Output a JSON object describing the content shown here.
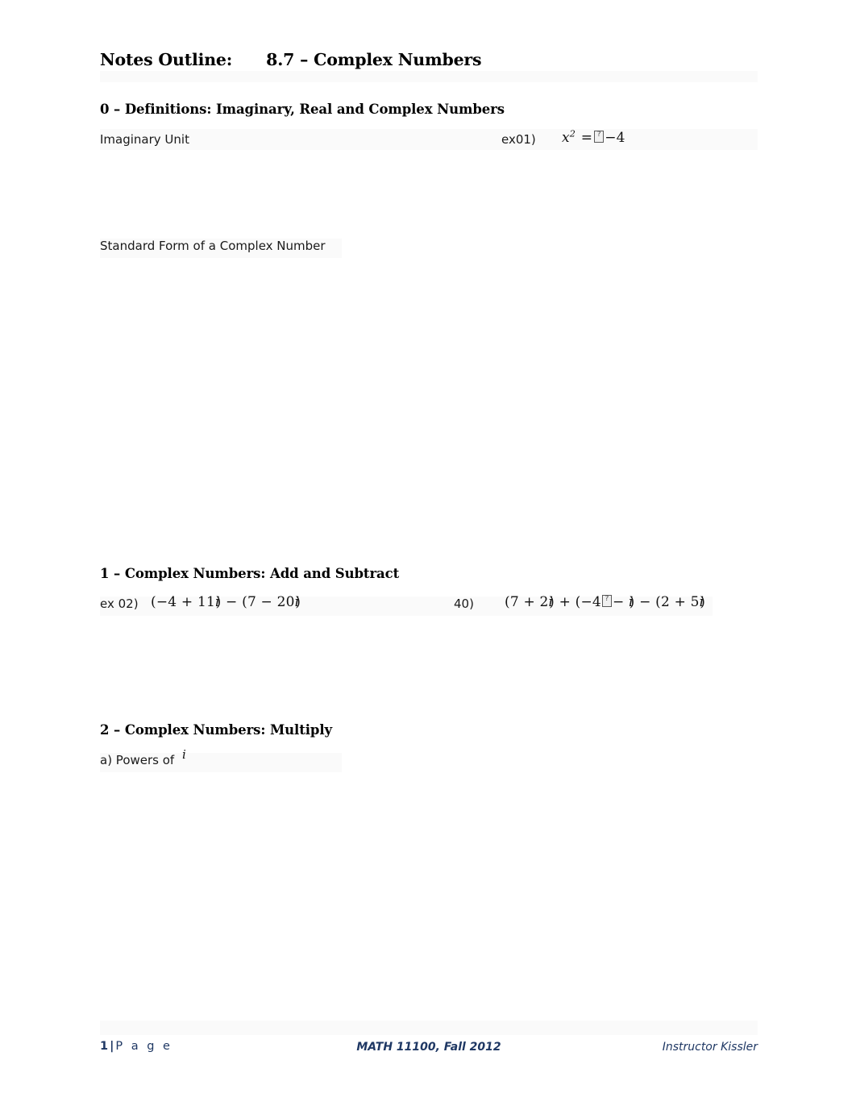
{
  "document": {
    "title_prefix": "Notes Outline:",
    "title_main": "8.7 – Complex Numbers",
    "accent_color": "#1f3864",
    "text_color": "#1a1a1a",
    "page_background": "#ffffff"
  },
  "sections": [
    {
      "heading": "0 – Definitions: Imaginary, Real and Complex Numbers",
      "items": [
        {
          "label": "Imaginary Unit"
        },
        {
          "label": "Standard Form of a Complex Number"
        }
      ],
      "examples": [
        {
          "number": "ex01)",
          "expression": "x² = ▯−4",
          "parts": {
            "variable": "x",
            "exponent": "2",
            "equals": "=",
            "missing_glyph": "▯",
            "value": "−4"
          }
        }
      ]
    },
    {
      "heading": "1 – Complex Numbers: Add and Subtract",
      "examples": [
        {
          "number": "ex 02)",
          "expression": "(−4 + 11i) − (7 − 20i)",
          "terms": [
            "(−4 + 11i)",
            "−",
            "(7 − 20i)"
          ]
        },
        {
          "number": "40)",
          "expression": "(7 + 2i) + (−4▯− i) − (2 + 5i)",
          "terms": [
            "(7 + 2i)",
            "+",
            "(−4▯− i)",
            "−",
            "(2 + 5i)"
          ]
        }
      ]
    },
    {
      "heading": "2 – Complex Numbers: Multiply",
      "items": [
        {
          "label": "a) Powers of",
          "trailing_symbol": "i"
        }
      ]
    }
  ],
  "footer": {
    "page_number": "1",
    "page_separator": "|",
    "page_word": "P a g e",
    "course": "MATH 11100, Fall 2012",
    "instructor": "Instructor Kissler"
  }
}
